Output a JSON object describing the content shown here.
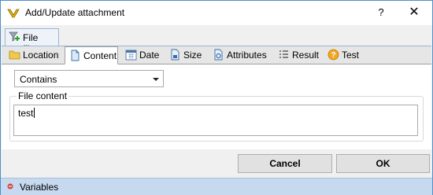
{
  "window": {
    "title": "Add/Update attachment",
    "help_label": "?",
    "close_label": "✕"
  },
  "outer_tab": {
    "label": "File filter",
    "icon": "funnel-add-icon"
  },
  "tabs": [
    {
      "label": "Location",
      "icon": "folder-icon"
    },
    {
      "label": "Content",
      "icon": "document-icon",
      "active": true
    },
    {
      "label": "Date",
      "icon": "calendar-icon"
    },
    {
      "label": "Size",
      "icon": "size-icon"
    },
    {
      "label": "Attributes",
      "icon": "attributes-icon"
    },
    {
      "label": "Result",
      "icon": "list-icon"
    },
    {
      "label": "Test",
      "icon": "question-icon"
    }
  ],
  "content": {
    "match_mode": "Contains",
    "file_content_label": "File content",
    "file_content_value": "test"
  },
  "buttons": {
    "cancel": "Cancel",
    "ok": "OK"
  },
  "statusbar": {
    "label": "Variables",
    "icon": "expand-icon"
  },
  "colors": {
    "accent": "#4f8fc9",
    "statusbar": "#c6d9ef",
    "tab_strip": "#e6e6e6"
  }
}
